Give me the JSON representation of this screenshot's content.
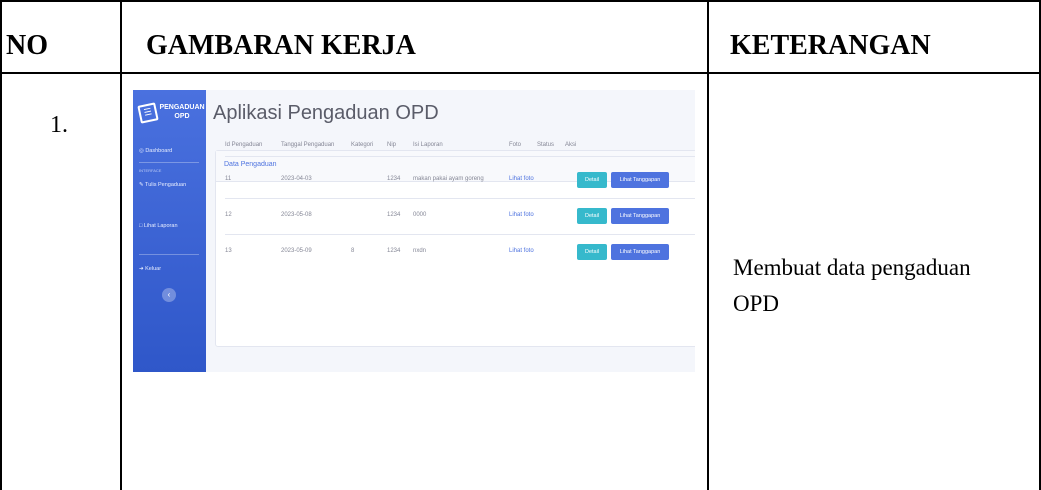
{
  "table": {
    "headers": {
      "no": "NO",
      "gambaran": "GAMBARAN KERJA",
      "keterangan": "KETERANGAN"
    },
    "rows": [
      {
        "no": "1.",
        "keterangan": "Membuat data pengaduan OPD"
      }
    ]
  },
  "screenshot": {
    "brand": "PENGADUAN OPD",
    "app_title": "Aplikasi Pengaduan OPD",
    "sidebar": {
      "items": [
        "Dashboard",
        "INTERFACE",
        "Tulis Pengaduan",
        "Lihat Laporan",
        "Keluar"
      ]
    },
    "card_title": "Data Pengaduan",
    "columns": [
      "Id Pengaduan",
      "Tanggal Pengaduan",
      "Kategori",
      "Nip",
      "Isi Laporan",
      "Foto",
      "Status",
      "Aksi"
    ],
    "rows": [
      {
        "id": "11",
        "tanggal": "2023-04-03",
        "kategori": "",
        "nip": "1234",
        "isi": "makan pakai ayam goreng",
        "foto": "Lihat foto",
        "status": ""
      },
      {
        "id": "12",
        "tanggal": "2023-05-08",
        "kategori": "",
        "nip": "1234",
        "isi": "0000",
        "foto": "Lihat foto",
        "status": ""
      },
      {
        "id": "13",
        "tanggal": "2023-05-09",
        "kategori": "8",
        "nip": "1234",
        "isi": "nxdn",
        "foto": "Lihat foto",
        "status": ""
      }
    ],
    "buttons": {
      "detail": "Detail",
      "lihat": "Lihat Tanggapan"
    }
  }
}
